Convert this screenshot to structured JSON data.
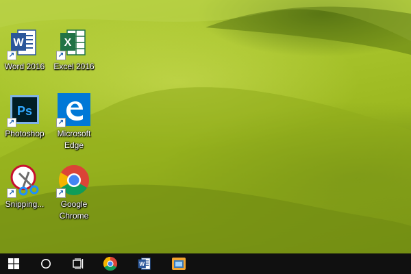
{
  "desktop": {
    "icons": [
      {
        "label": "Word 2016",
        "icon": "word-icon",
        "color": "#2b579a"
      },
      {
        "label": "Excel 2016",
        "icon": "excel-icon",
        "color": "#217346"
      },
      {
        "label": "Photoshop",
        "icon": "photoshop-icon",
        "color": "#001d26"
      },
      {
        "label": "Microsoft Edge",
        "label_line1": "Microsoft",
        "label_line2": "Edge",
        "icon": "edge-icon",
        "color": "#0078d7"
      },
      {
        "label": "Snipping...",
        "icon": "snipping-tool-icon",
        "color": "#c8102e"
      },
      {
        "label": "Google Chrome",
        "label_line1": "Google",
        "label_line2": "Chrome",
        "icon": "chrome-icon",
        "color": "#4285f4"
      }
    ]
  },
  "taskbar": {
    "items": [
      {
        "icon": "windows-start-icon"
      },
      {
        "icon": "cortana-search-icon"
      },
      {
        "icon": "task-view-icon"
      },
      {
        "icon": "chrome-icon"
      },
      {
        "icon": "word-icon"
      },
      {
        "icon": "app-window-icon"
      }
    ]
  }
}
